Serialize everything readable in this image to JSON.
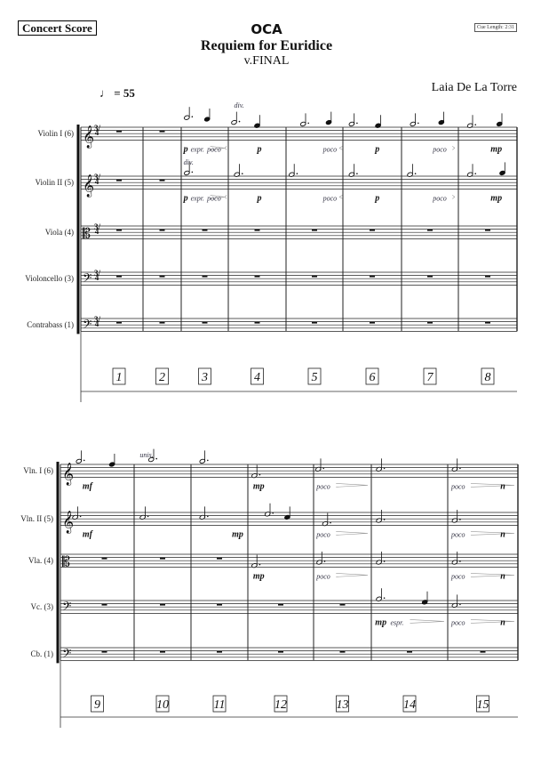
{
  "header": {
    "score_type": "Concert Score",
    "cue_length": "Cue Length: 2:31",
    "title": "OCA",
    "subtitle": "Requiem for Euridice",
    "version": "v.FINAL",
    "composer": "Laia De La Torre",
    "tempo": "= 55",
    "time_signature": "3/4"
  },
  "systems": [
    {
      "labels": [
        "Violin I (6)",
        "Violin II (5)",
        "Viola (4)",
        "Violoncello (3)",
        "Contrabass (1)"
      ],
      "clefs": [
        "treble",
        "treble",
        "alto",
        "bass",
        "bass"
      ],
      "show_time_signature": true,
      "measure_numbers": [
        "1",
        "2",
        "3",
        "4",
        "5",
        "6",
        "7",
        "8"
      ],
      "rests": [
        [
          0,
          1
        ],
        [
          0,
          1
        ],
        [
          0,
          1,
          2,
          3,
          4,
          5,
          6,
          7
        ],
        [
          0,
          1,
          2,
          3,
          4,
          5,
          6,
          7
        ],
        [
          0,
          1,
          2,
          3,
          4,
          5,
          6,
          7
        ]
      ],
      "markings": [
        {
          "staff": 0,
          "measure": 2,
          "pos": 0.05,
          "text": "p",
          "style": "dyn"
        },
        {
          "staff": 0,
          "measure": 2,
          "pos": 0.2,
          "text": "expr.",
          "style": "txt"
        },
        {
          "staff": 0,
          "measure": 2,
          "pos": 0.55,
          "text": "poco",
          "style": "txt"
        },
        {
          "staff": 0,
          "measure": 3,
          "pos": 0.5,
          "text": "p",
          "style": "dyn"
        },
        {
          "staff": 0,
          "measure": 3,
          "pos": 0.1,
          "text": "div.",
          "style": "above"
        },
        {
          "staff": 0,
          "measure": 4,
          "pos": 0.65,
          "text": "poco",
          "style": "txt"
        },
        {
          "staff": 0,
          "measure": 5,
          "pos": 0.55,
          "text": "p",
          "style": "dyn"
        },
        {
          "staff": 0,
          "measure": 6,
          "pos": 0.55,
          "text": "poco",
          "style": "txt"
        },
        {
          "staff": 0,
          "measure": 7,
          "pos": 0.55,
          "text": "mp",
          "style": "dyn"
        },
        {
          "staff": 1,
          "measure": 2,
          "pos": 0.05,
          "text": "div.",
          "style": "above"
        },
        {
          "staff": 1,
          "measure": 2,
          "pos": 0.05,
          "text": "p",
          "style": "dyn"
        },
        {
          "staff": 1,
          "measure": 2,
          "pos": 0.2,
          "text": "expr.",
          "style": "txt"
        },
        {
          "staff": 1,
          "measure": 2,
          "pos": 0.55,
          "text": "poco",
          "style": "txt"
        },
        {
          "staff": 1,
          "measure": 3,
          "pos": 0.5,
          "text": "p",
          "style": "dyn"
        },
        {
          "staff": 1,
          "measure": 4,
          "pos": 0.65,
          "text": "poco",
          "style": "txt"
        },
        {
          "staff": 1,
          "measure": 5,
          "pos": 0.55,
          "text": "p",
          "style": "dyn"
        },
        {
          "staff": 1,
          "measure": 6,
          "pos": 0.55,
          "text": "poco",
          "style": "txt"
        },
        {
          "staff": 1,
          "measure": 7,
          "pos": 0.55,
          "text": "mp",
          "style": "dyn"
        }
      ]
    },
    {
      "labels": [
        "Vln. I (6)",
        "Vln. II (5)",
        "Vla. (4)",
        "Vc. (3)",
        "Cb. (1)"
      ],
      "clefs": [
        "treble",
        "treble",
        "alto",
        "bass",
        "bass"
      ],
      "show_time_signature": false,
      "measure_numbers": [
        "9",
        "10",
        "11",
        "12",
        "13",
        "14",
        "15"
      ],
      "rests": [
        [],
        [],
        [
          0,
          1,
          2
        ],
        [
          0,
          1,
          2,
          3,
          4
        ],
        [
          0,
          1,
          2,
          3,
          4,
          5,
          6
        ]
      ],
      "markings": [
        {
          "staff": 0,
          "measure": 0,
          "pos": 0.3,
          "text": "mf",
          "style": "dyn"
        },
        {
          "staff": 0,
          "measure": 1,
          "pos": 0.1,
          "text": "unis.",
          "style": "above"
        },
        {
          "staff": 0,
          "measure": 3,
          "pos": 0.08,
          "text": "mp",
          "style": "dyn"
        },
        {
          "staff": 0,
          "measure": 4,
          "pos": 0.05,
          "text": "poco",
          "style": "txt"
        },
        {
          "staff": 0,
          "measure": 6,
          "pos": 0.05,
          "text": "poco",
          "style": "txt"
        },
        {
          "staff": 0,
          "measure": 6,
          "pos": 0.75,
          "text": "n",
          "style": "dyn"
        },
        {
          "staff": 1,
          "measure": 0,
          "pos": 0.3,
          "text": "mf",
          "style": "dyn"
        },
        {
          "staff": 1,
          "measure": 2,
          "pos": 0.72,
          "text": "mp",
          "style": "dyn"
        },
        {
          "staff": 1,
          "measure": 4,
          "pos": 0.05,
          "text": "poco",
          "style": "txt"
        },
        {
          "staff": 1,
          "measure": 6,
          "pos": 0.05,
          "text": "poco",
          "style": "txt"
        },
        {
          "staff": 1,
          "measure": 6,
          "pos": 0.75,
          "text": "n",
          "style": "dyn"
        },
        {
          "staff": 2,
          "measure": 3,
          "pos": 0.08,
          "text": "mp",
          "style": "dyn"
        },
        {
          "staff": 2,
          "measure": 4,
          "pos": 0.05,
          "text": "poco",
          "style": "txt"
        },
        {
          "staff": 2,
          "measure": 6,
          "pos": 0.05,
          "text": "poco",
          "style": "txt"
        },
        {
          "staff": 2,
          "measure": 6,
          "pos": 0.75,
          "text": "n",
          "style": "dyn"
        },
        {
          "staff": 3,
          "measure": 5,
          "pos": 0.05,
          "text": "mp",
          "style": "dyn"
        },
        {
          "staff": 3,
          "measure": 5,
          "pos": 0.25,
          "text": "espr.",
          "style": "txt"
        },
        {
          "staff": 3,
          "measure": 6,
          "pos": 0.05,
          "text": "poco",
          "style": "txt"
        },
        {
          "staff": 3,
          "measure": 6,
          "pos": 0.75,
          "text": "n",
          "style": "dyn"
        }
      ]
    }
  ]
}
